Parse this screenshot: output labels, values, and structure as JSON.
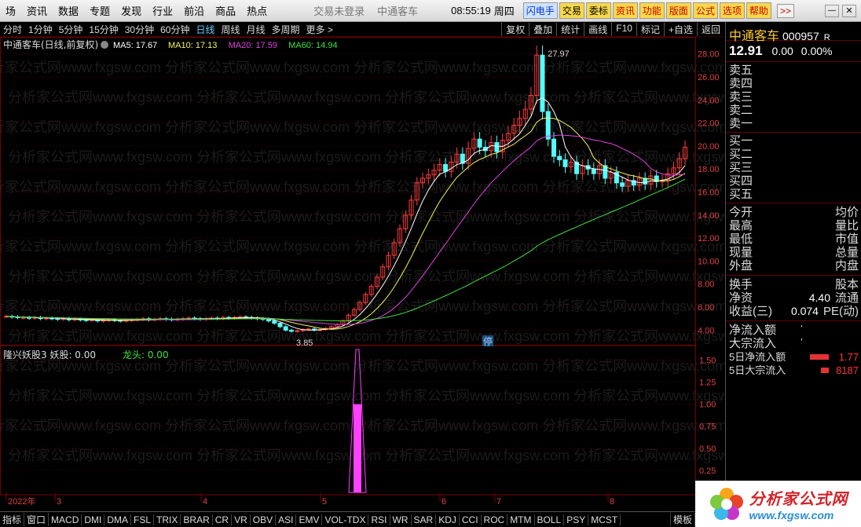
{
  "menu": {
    "items": [
      "场",
      "资讯",
      "数据",
      "专题",
      "发现",
      "行业",
      "前沿",
      "商品",
      "热点"
    ],
    "login_status": "交易未登录",
    "stock_name_hdr": "中通客车",
    "clock": "08:55:19",
    "weekday": "周四",
    "buttons": [
      "闪电手",
      "交易",
      "委标",
      "资讯",
      "功能",
      "版面",
      "公式",
      "选项",
      "帮助"
    ],
    "more": ">>"
  },
  "toolbar": {
    "periods": [
      "分时",
      "1分钟",
      "5分钟",
      "15分钟",
      "30分钟",
      "60分钟",
      "日线",
      "周线",
      "月线",
      "多周期",
      "更多 >"
    ],
    "active": "日线",
    "right": [
      "复权",
      "叠加",
      "统计",
      "画线",
      "F10",
      "标记",
      "+自选",
      "返回"
    ]
  },
  "chart": {
    "title": "中通客车(日线,前复权)",
    "ma": [
      {
        "label": "MA5: 17.67",
        "color": "#ffffff"
      },
      {
        "label": "MA10: 17.13",
        "color": "#f5f55a"
      },
      {
        "label": "MA20: 17.59",
        "color": "#e040e0"
      },
      {
        "label": "MA60: 14.94",
        "color": "#40e040"
      }
    ],
    "high_label": "27.97",
    "low_label": "3.85",
    "halt_label": "停",
    "watermark": "分析家公式网www.fxgsw.com 分析家公式网www.fxgsw.com"
  },
  "chart_data": {
    "type": "line",
    "main_y_ticks": [
      "28.00",
      "26.00",
      "24.00",
      "22.00",
      "20.00",
      "18.00",
      "16.00",
      "14.00",
      "12.00",
      "10.00",
      "8.00",
      "6.00",
      "4.00"
    ],
    "sub_y_ticks": [
      "1.50",
      "1.25",
      "1.00",
      "0.75",
      "0.50",
      "0.25"
    ],
    "x_ticks": [
      "2022年",
      "3",
      "4",
      "5",
      "6",
      "7",
      "8"
    ],
    "close": [
      5.2,
      5.15,
      5.1,
      5.1,
      5.05,
      5.1,
      5.0,
      5.05,
      5.0,
      4.95,
      5.0,
      4.9,
      4.95,
      4.9,
      4.85,
      4.9,
      4.8,
      4.85,
      4.9,
      4.85,
      4.8,
      4.85,
      4.9,
      4.95,
      5.0,
      4.9,
      4.95,
      5.0,
      4.95,
      4.9,
      4.95,
      5.0,
      5.05,
      5.0,
      4.95,
      5.0,
      5.05,
      5.0,
      5.1,
      5.05,
      5.1,
      5.15,
      5.1,
      5.05,
      5.0,
      4.95,
      4.8,
      4.6,
      4.3,
      4.0,
      3.9,
      3.95,
      4.05,
      4.1,
      4.0,
      4.05,
      4.15,
      4.3,
      4.5,
      4.8,
      5.3,
      5.8,
      6.4,
      7.1,
      7.8,
      8.6,
      9.5,
      10.5,
      11.6,
      12.8,
      14.0,
      15.3,
      16.8,
      17.2,
      17.5,
      17.9,
      18.4,
      17.8,
      18.6,
      19.3,
      18.5,
      19.8,
      20.6,
      19.9,
      19.6,
      20.3,
      19.5,
      20.5,
      21.1,
      21.8,
      22.4,
      23.2,
      24.4,
      27.9,
      23.0,
      20.6,
      19.1,
      18.8,
      18.2,
      18.6,
      17.6,
      18.3,
      18.0,
      17.6,
      18.3,
      17.2,
      17.7,
      16.8,
      16.5,
      17.0,
      16.6,
      17.2,
      16.7,
      17.4,
      16.9,
      17.0,
      17.6,
      18.1,
      18.9,
      19.9
    ],
    "series": [
      {
        "name": "MA5",
        "color": "#ffffff",
        "values": []
      },
      {
        "name": "MA10",
        "color": "#f5f55a",
        "values": []
      },
      {
        "name": "MA20",
        "color": "#e040e0",
        "values": []
      },
      {
        "name": "MA60",
        "color": "#40e040",
        "values": []
      }
    ]
  },
  "sub": {
    "title": "隆兴妖股3 妖股: 0.00",
    "dragon": "龙头: 0.00"
  },
  "quote": {
    "name": "中通客车",
    "code": "000957",
    "r_mark": "R",
    "price": "12.91",
    "change": "0.00",
    "pct": "0.00%",
    "asks": [
      "卖五",
      "卖四",
      "卖三",
      "卖二",
      "卖一"
    ],
    "bids": [
      "买一",
      "买二",
      "买三",
      "买四",
      "买五"
    ],
    "fields": [
      [
        "今开",
        "均价"
      ],
      [
        "最高",
        "量比"
      ],
      [
        "最低",
        "市值"
      ],
      [
        "现量",
        "总量"
      ],
      [
        "外盘",
        "内盘"
      ]
    ],
    "fields2": [
      [
        "换手",
        "",
        "股本"
      ],
      [
        "净资",
        "4.40",
        "流通"
      ],
      [
        "收益(三)",
        "0.074",
        "PE(动)"
      ]
    ],
    "flows": [
      "净流入额",
      "大宗流入"
    ],
    "flows5": [
      {
        "label": "5日净流入额",
        "value": "1.77"
      },
      {
        "label": "5日大宗流入",
        "value": "8187"
      }
    ]
  },
  "bottom": {
    "tabs": [
      "指标",
      "窗口",
      "MACD",
      "DMI",
      "DMA",
      "FSL",
      "TRIX",
      "BRAR",
      "CR",
      "VR",
      "OBV",
      "ASI",
      "EMV",
      "VOL-TDX",
      "RSI",
      "WR",
      "SAR",
      "KDJ",
      "CCI",
      "ROC",
      "MTM",
      "BOLL",
      "PSY",
      "MCST"
    ],
    "right": "模板"
  },
  "logo": {
    "text": "分析家公式网",
    "url": "www.fxgsw.com"
  }
}
